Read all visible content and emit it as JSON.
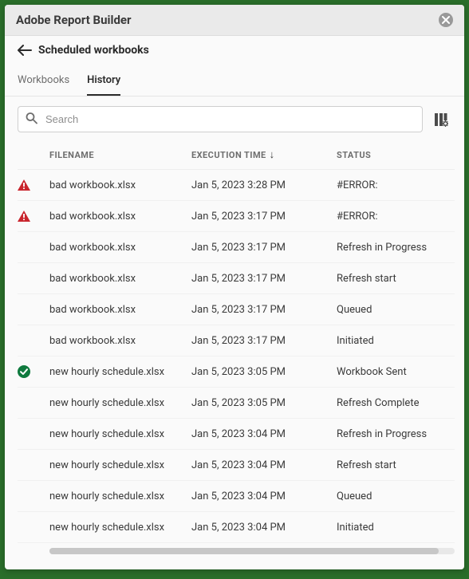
{
  "window": {
    "title": "Adobe Report Builder"
  },
  "header": {
    "title": "Scheduled workbooks"
  },
  "tabs": [
    {
      "id": "workbooks",
      "label": "Workbooks",
      "active": false
    },
    {
      "id": "history",
      "label": "History",
      "active": true
    }
  ],
  "search": {
    "placeholder": "Search",
    "value": ""
  },
  "columns": {
    "filename": "FILENAME",
    "execution_time": "EXECUTION TIME",
    "status": "STATUS",
    "sort": {
      "column": "execution_time",
      "direction": "desc"
    }
  },
  "rows": [
    {
      "icon": "error",
      "filename": "bad workbook.xlsx",
      "time": "Jan 5, 2023 3:28 PM",
      "status": "#ERROR:"
    },
    {
      "icon": "error",
      "filename": "bad workbook.xlsx",
      "time": "Jan 5, 2023 3:17 PM",
      "status": "#ERROR:"
    },
    {
      "icon": "none",
      "filename": "bad workbook.xlsx",
      "time": "Jan 5, 2023 3:17 PM",
      "status": "Refresh in Progress"
    },
    {
      "icon": "none",
      "filename": "bad workbook.xlsx",
      "time": "Jan 5, 2023 3:17 PM",
      "status": "Refresh start"
    },
    {
      "icon": "none",
      "filename": "bad workbook.xlsx",
      "time": "Jan 5, 2023 3:17 PM",
      "status": "Queued"
    },
    {
      "icon": "none",
      "filename": "bad workbook.xlsx",
      "time": "Jan 5, 2023 3:17 PM",
      "status": "Initiated"
    },
    {
      "icon": "success",
      "filename": "new hourly schedule.xlsx",
      "time": "Jan 5, 2023 3:05 PM",
      "status": "Workbook Sent"
    },
    {
      "icon": "none",
      "filename": "new hourly schedule.xlsx",
      "time": "Jan 5, 2023 3:05 PM",
      "status": "Refresh Complete"
    },
    {
      "icon": "none",
      "filename": "new hourly schedule.xlsx",
      "time": "Jan 5, 2023 3:04 PM",
      "status": "Refresh in Progress"
    },
    {
      "icon": "none",
      "filename": "new hourly schedule.xlsx",
      "time": "Jan 5, 2023 3:04 PM",
      "status": "Refresh start"
    },
    {
      "icon": "none",
      "filename": "new hourly schedule.xlsx",
      "time": "Jan 5, 2023 3:04 PM",
      "status": "Queued"
    },
    {
      "icon": "none",
      "filename": "new hourly schedule.xlsx",
      "time": "Jan 5, 2023 3:04 PM",
      "status": "Initiated"
    }
  ]
}
